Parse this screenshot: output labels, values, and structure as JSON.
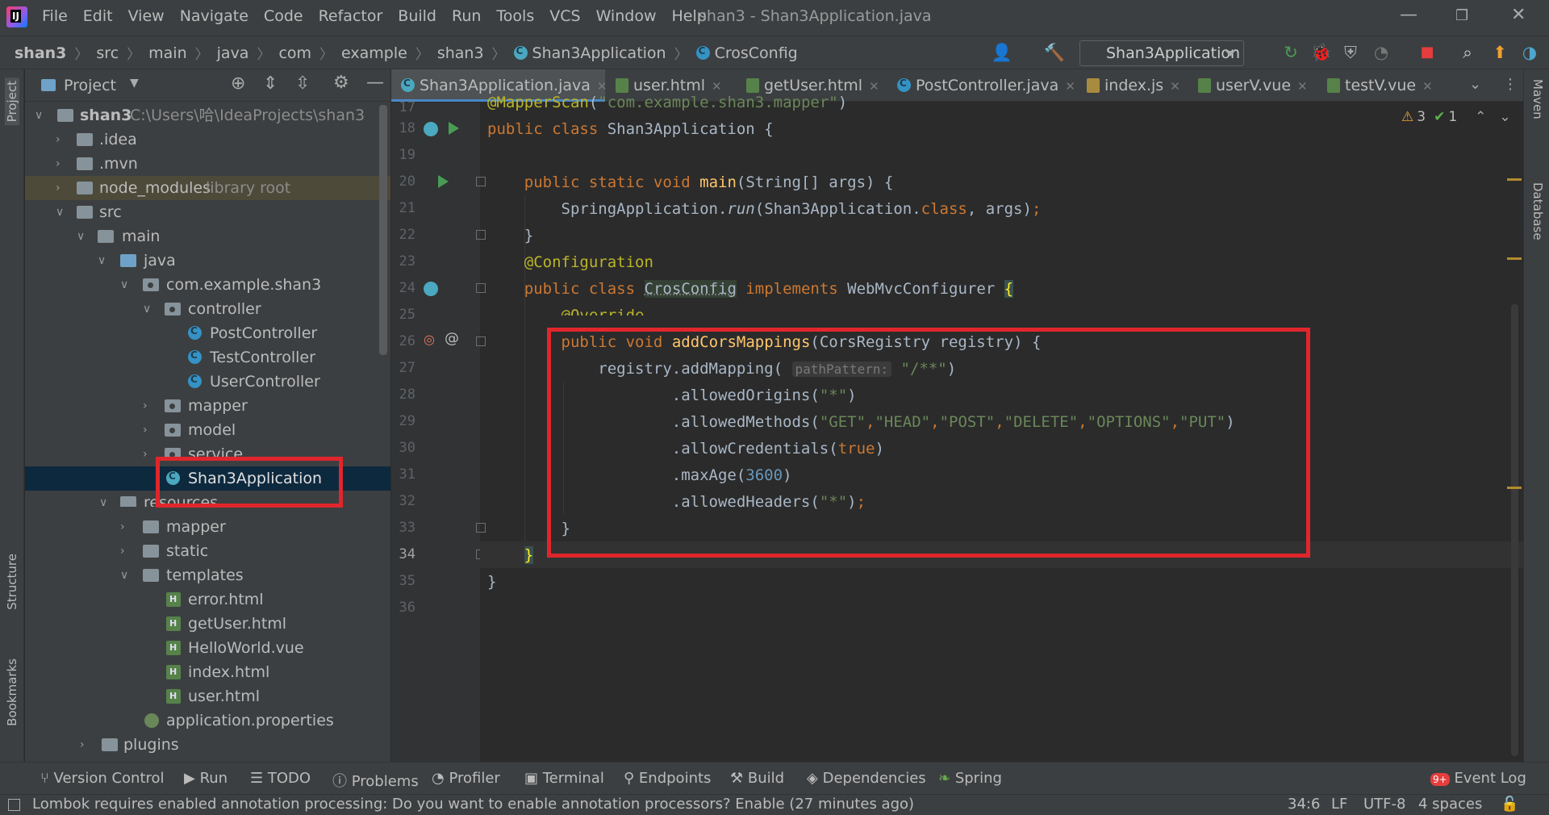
{
  "menubar": {
    "items": [
      "File",
      "Edit",
      "View",
      "Navigate",
      "Code",
      "Refactor",
      "Build",
      "Run",
      "Tools",
      "VCS",
      "Window",
      "Help"
    ],
    "title": "shan3 - Shan3Application.java"
  },
  "breadcrumbs": [
    "shan3",
    "src",
    "main",
    "java",
    "com",
    "example",
    "shan3",
    "Shan3Application",
    "CrosConfig"
  ],
  "run_config": "Shan3Application",
  "project": {
    "title": "Project",
    "root_name": "shan3",
    "root_path": "C:\\Users\\哈\\IdeaProjects\\shan3",
    "items": {
      "idea": ".idea",
      "mvn": ".mvn",
      "node_modules": "node_modules",
      "library_root": "library root",
      "src": "src",
      "main": "main",
      "java": "java",
      "pkg": "com.example.shan3",
      "controller": "controller",
      "post": "PostController",
      "test": "TestController",
      "user": "UserController",
      "mapper": "mapper",
      "model": "model",
      "service": "service",
      "app": "Shan3Application",
      "resources": "resources",
      "res_mapper": "mapper",
      "static": "static",
      "templates": "templates",
      "error": "error.html",
      "getuser": "getUser.html",
      "hello": "HelloWorld.vue",
      "index": "index.html",
      "userhtml": "user.html",
      "props": "application.properties",
      "plugins": "plugins"
    }
  },
  "tabs": [
    "Shan3Application.java",
    "user.html",
    "getUser.html",
    "PostController.java",
    "index.js",
    "userV.vue",
    "testV.vue"
  ],
  "inspections": {
    "warnings": "3",
    "ok": "1"
  },
  "editor": {
    "line_numbers": [
      "17",
      "18",
      "19",
      "20",
      "21",
      "22",
      "23",
      "24",
      "25",
      "26",
      "27",
      "28",
      "29",
      "30",
      "31",
      "32",
      "33",
      "34",
      "35",
      "36"
    ],
    "current_line": "34"
  },
  "left_strip": {
    "project": "Project",
    "structure": "Structure",
    "bookmarks": "Bookmarks"
  },
  "right_strip": {
    "maven": "Maven",
    "database": "Database"
  },
  "bottom_tools": [
    "Version Control",
    "Run",
    "TODO",
    "Problems",
    "Profiler",
    "Terminal",
    "Endpoints",
    "Build",
    "Dependencies",
    "Spring"
  ],
  "event_log": {
    "badge": "9+",
    "label": "Event Log"
  },
  "status": {
    "message": "Lombok requires enabled annotation processing: Do you want to enable annotation processors? Enable (27 minutes ago)",
    "position": "34:6",
    "line_sep": "LF",
    "encoding": "UTF-8",
    "indent": "4 spaces"
  }
}
